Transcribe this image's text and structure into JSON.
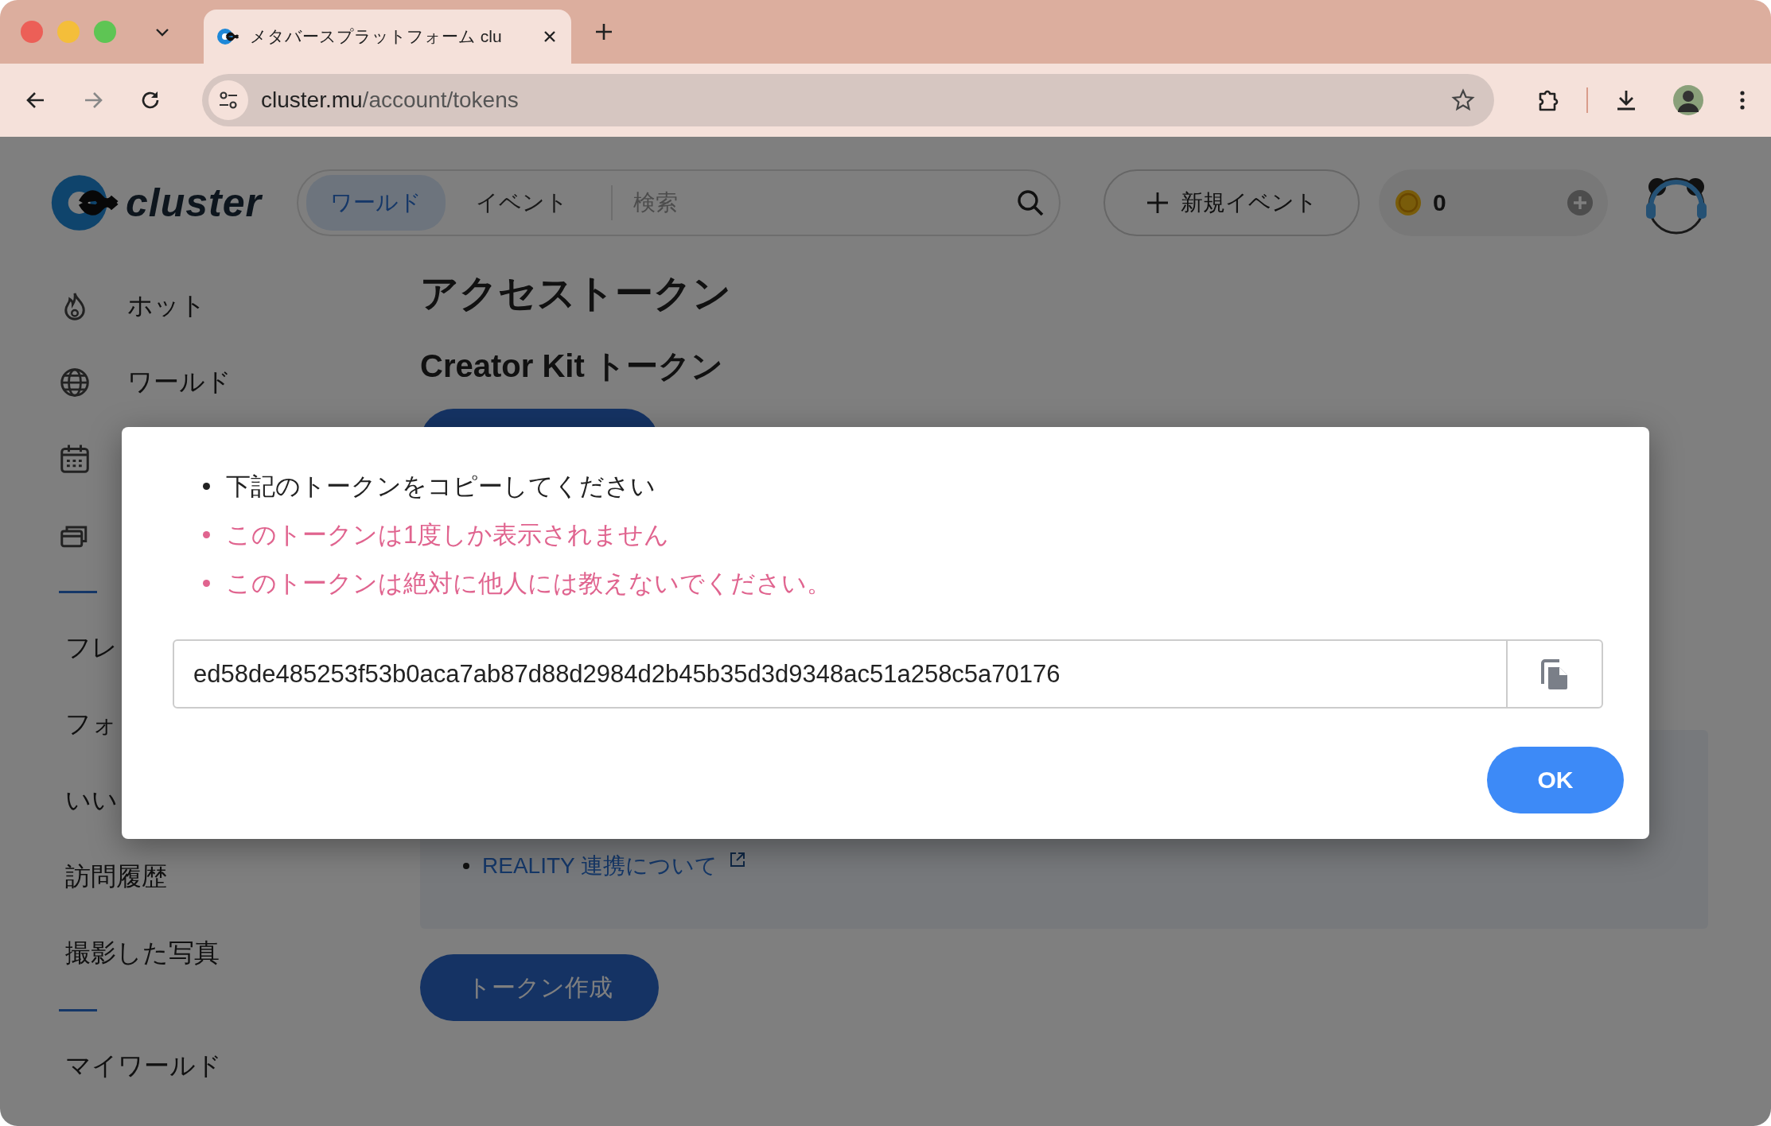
{
  "browser": {
    "tab": {
      "title": "メタバースプラットフォーム clu",
      "selected": true
    },
    "address": {
      "host": "cluster.mu",
      "path": "/account/tokens"
    }
  },
  "header": {
    "logo": "cluster",
    "nav_tabs": [
      {
        "label": "ワールド",
        "selected": true
      },
      {
        "label": "イベント",
        "selected": false
      }
    ],
    "search": {
      "placeholder": "検索"
    },
    "new_event_button": "新規イベント",
    "coins": "0"
  },
  "sidebar": {
    "groups": [
      [
        {
          "kind": "icon",
          "label": "ホット"
        },
        {
          "kind": "icon",
          "label": "ワールド"
        },
        {
          "kind": "icon"
        },
        {
          "kind": "icon"
        }
      ],
      [
        {
          "label": "フレ"
        },
        {
          "label": "フォ"
        },
        {
          "label": "いい"
        },
        {
          "label": "訪問履歴"
        },
        {
          "label": "撮影した写真"
        }
      ],
      [
        {
          "label": "マイワールド"
        }
      ]
    ]
  },
  "main": {
    "title": "アクセストークン",
    "section_title": "Creator Kit トークン",
    "info_link": "REALITY 連携について",
    "create_button": "トークン作成"
  },
  "modal": {
    "notes": [
      {
        "kind": "normal",
        "text": "下記のトークンをコピーしてください"
      },
      {
        "kind": "warning",
        "text": "このトークンは1度しか表示されません"
      },
      {
        "kind": "warning",
        "text": "このトークンは絶対に他人には教えないでください。"
      }
    ],
    "token": "ed58de485253f53b0aca7ab87d88d2984d2b45b35d3d9348ac51a258c5a70176",
    "ok_button": "OK"
  }
}
